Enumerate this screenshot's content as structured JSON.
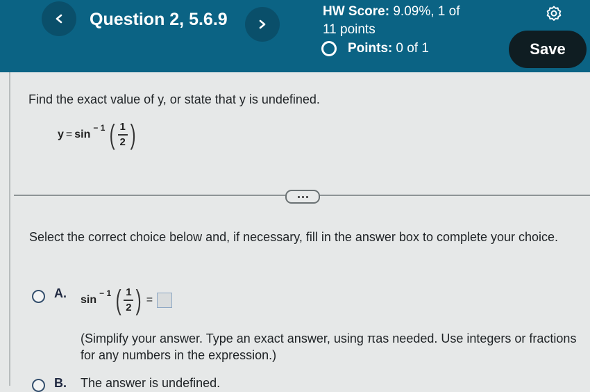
{
  "header": {
    "question_title": "Question 2, 5.6.9",
    "prev_icon": "chevron-left-icon",
    "next_icon": "chevron-right-icon",
    "hw_score_label": "HW Score:",
    "hw_score_value": "9.09%, 1 of 11 points",
    "points_label": "Points:",
    "points_value": "0 of 1",
    "settings_icon": "gear-icon",
    "save_label": "Save"
  },
  "question": {
    "prompt": "Find the exact value of y, or state that y is undefined.",
    "equation": {
      "lhs": "y",
      "equals": "=",
      "func": "sin",
      "exponent": "− 1",
      "numerator": "1",
      "denominator": "2"
    },
    "more_button_icon": "ellipsis-icon",
    "instruction": "Select the correct choice below and, if necessary, fill in the answer box to complete your choice."
  },
  "choices": [
    {
      "letter": "A.",
      "expression": {
        "func": "sin",
        "exponent": "− 1",
        "numerator": "1",
        "denominator": "2",
        "equals": "="
      },
      "answer_value": "",
      "hint": "(Simplify your answer. Type an exact answer, using πas needed. Use integers or fractions for any numbers in the expression.)"
    },
    {
      "letter": "B.",
      "text": "The answer is undefined."
    }
  ]
}
